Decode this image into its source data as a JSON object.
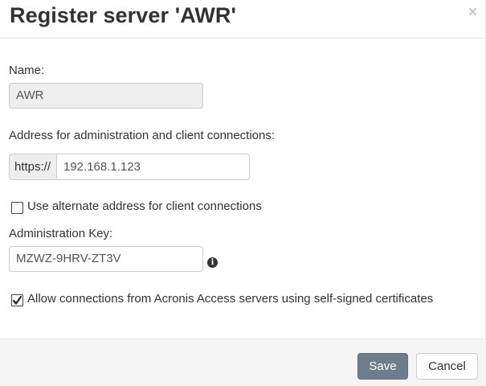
{
  "dialog": {
    "title": "Register server 'AWR'",
    "close_glyph": "×"
  },
  "form": {
    "name_label": "Name:",
    "name_value": "AWR",
    "address_label": "Address for administration and client connections:",
    "address_prefix": "https://",
    "address_value": "192.168.1.123",
    "alternate_address": {
      "label": "Use alternate address for client connections",
      "checked": false
    },
    "admin_key_label": "Administration Key:",
    "admin_key_value": "MZWZ-9HRV-ZT3V",
    "info_icon": "info-icon",
    "self_signed": {
      "label": "Allow connections from Acronis Access servers using self-signed certificates",
      "checked": true
    }
  },
  "footer": {
    "save_label": "Save",
    "cancel_label": "Cancel"
  },
  "colors": {
    "save_button": "#6d7d8b",
    "footer_bg": "#f5f5f5",
    "disabled_input_bg": "#eeeeee"
  }
}
